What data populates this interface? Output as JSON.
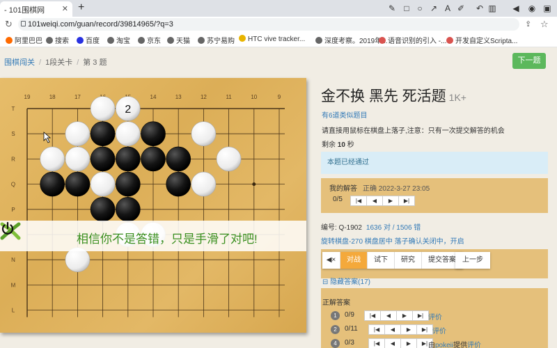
{
  "browser": {
    "tab_title": "- 101围棋网",
    "url": "101weiqi.com/guan/record/39814965/?q=3"
  },
  "bookmarks": [
    {
      "label": "阿里巴巴",
      "color": "#ff6a00"
    },
    {
      "label": "搜索",
      "color": "#666666"
    },
    {
      "label": "百度",
      "color": "#2932e1"
    },
    {
      "label": "淘宝",
      "color": "#666666"
    },
    {
      "label": "京东",
      "color": "#666666"
    },
    {
      "label": "天猫",
      "color": "#666666"
    },
    {
      "label": "苏宁易购",
      "color": "#666666"
    },
    {
      "label": "HTC vive tracker...",
      "color": "#e8b400"
    },
    {
      "label": "深度考察。2019年...",
      "color": "#666666"
    },
    {
      "label": "语音识别的引入 -...",
      "color": "#d9534f"
    },
    {
      "label": "开发自定义Scripta...",
      "color": "#d9534f"
    }
  ],
  "breadcrumb": {
    "home": "围棋闯关",
    "level": "1段关卡",
    "current": "第 3 题"
  },
  "next_button": "下一题",
  "board": {
    "col_labels": [
      "19",
      "18",
      "17",
      "16",
      "15",
      "14",
      "13",
      "12",
      "11",
      "10",
      "9"
    ],
    "row_labels": [
      "T",
      "S",
      "R",
      "Q",
      "P",
      "O",
      "N",
      "M",
      "L"
    ],
    "move_number": "2",
    "black_stones": [
      [
        3,
        1
      ],
      [
        5,
        1
      ],
      [
        3,
        2
      ],
      [
        4,
        2
      ],
      [
        5,
        2
      ],
      [
        6,
        2
      ],
      [
        1,
        3
      ],
      [
        2,
        3
      ],
      [
        4,
        3
      ],
      [
        6,
        3
      ],
      [
        3,
        4
      ],
      [
        4,
        4
      ]
    ],
    "white_stones": [
      [
        3,
        0
      ],
      [
        4,
        0
      ],
      [
        2,
        1
      ],
      [
        4,
        1
      ],
      [
        7,
        1
      ],
      [
        1,
        2
      ],
      [
        2,
        2
      ],
      [
        8,
        2
      ],
      [
        3,
        3
      ],
      [
        7,
        3
      ],
      [
        4,
        5
      ],
      [
        5,
        5
      ],
      [
        2,
        6
      ]
    ],
    "marked_stone": [
      4,
      0
    ]
  },
  "wrong_message": "相信你不是答错，只是手滑了对吧!",
  "problem": {
    "title": "金不换 黑先 死活题",
    "level": "1K+",
    "similar": "有6道类似题目",
    "instruction": "请直接用鼠标在棋盘上落子,注意：只有一次提交解答的机会",
    "remain_label": "剩余",
    "remain_value": "10",
    "remain_unit": "秒",
    "passed_notice": "本题已经通过",
    "my_answer_label": "我的解答",
    "my_answer_status": "正确 2022-3-27 23:05",
    "my_answer_count": "0/5",
    "id_label": "编号: Q-1902",
    "stats": "1636 对 / 1506 错",
    "rotate": "旋转棋盘-270 棋盘居中 落子确认关闭中，开启"
  },
  "modes": {
    "mute": "◀×",
    "fight": "对战",
    "try": "试下",
    "research": "研究",
    "submit": "提交答案",
    "prev": "上一步"
  },
  "answers": {
    "hide_label": "隐藏答案(17)",
    "correct_label": "正解答案",
    "rows": [
      {
        "num": "1",
        "count": "0/9",
        "rate": "评价",
        "provider_prefix": "",
        "provider": "",
        "provider_suffix": ""
      },
      {
        "num": "2",
        "count": "0/11",
        "rate": "评价",
        "provider_prefix": "",
        "provider": "",
        "provider_suffix": ""
      },
      {
        "num": "4",
        "count": "0/3",
        "rate": "评价",
        "provider_prefix": "由",
        "provider": "pokeii",
        "provider_suffix": "提供"
      }
    ]
  }
}
